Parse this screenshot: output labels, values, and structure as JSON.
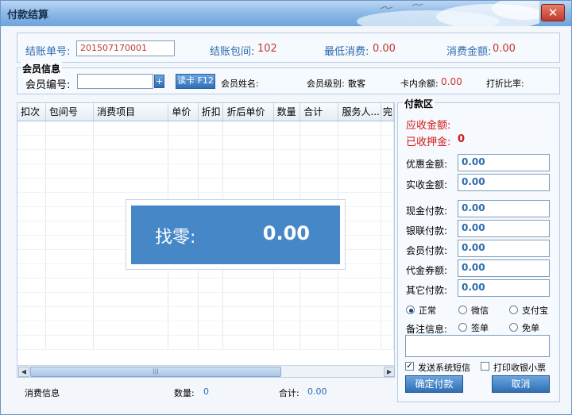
{
  "window": {
    "title": "付款结算",
    "close_label": "✕"
  },
  "header": {
    "bill_no_label": "结账单号:",
    "bill_no_value": "201507170001",
    "room_label": "结账包间:",
    "room_value": "102",
    "min_consume_label": "最低消费:",
    "min_consume_value": "0.00",
    "consume_amount_label": "消费金额:",
    "consume_amount_value": "0.00"
  },
  "member": {
    "group_title": "会员信息",
    "no_label": "会员编号:",
    "no_value": "",
    "add_label": "+",
    "read_card_label": "读卡 F12",
    "name_label": "会员姓名:",
    "name_value": "",
    "level_label": "会员级别:",
    "level_value": "散客",
    "balance_label": "卡内余额:",
    "balance_value": "0.00",
    "discount_label": "打折比率:",
    "discount_value": ""
  },
  "grid": {
    "columns": [
      "扣次",
      "包间号",
      "消费项目",
      "单价",
      "折扣",
      "折后单价",
      "数量",
      "合计",
      "服务人...",
      "完"
    ]
  },
  "change": {
    "label": "找零:",
    "value": "0.00"
  },
  "footer": {
    "info_label": "消费信息",
    "qty_label": "数量:",
    "qty_value": "0",
    "total_label": "合计:",
    "total_value": "0.00"
  },
  "payment": {
    "group_title": "付款区",
    "receivable_label": "应收金额:",
    "receivable_value": "",
    "deposit_label": "已收押金:",
    "deposit_value": "0",
    "discount_amount_label": "优惠金额:",
    "discount_amount_value": "0.00",
    "actual_label": "实收金额:",
    "actual_value": "0.00",
    "cash_label": "现金付款:",
    "cash_value": "0.00",
    "unionpay_label": "银联付款:",
    "unionpay_value": "0.00",
    "member_pay_label": "会员付款:",
    "member_pay_value": "0.00",
    "voucher_label": "代金券额:",
    "voucher_value": "0.00",
    "other_label": "其它付款:",
    "other_value": "0.00",
    "mode_normal": "正常",
    "mode_wechat": "微信",
    "mode_alipay": "支付宝",
    "remark_label": "备注信息:",
    "mode_sign": "签单",
    "mode_free": "免单",
    "remark_value": "",
    "sms_label": "发送系统短信",
    "print_label": "打印收银小票",
    "confirm_label": "确定付款",
    "cancel_label": "取消"
  }
}
